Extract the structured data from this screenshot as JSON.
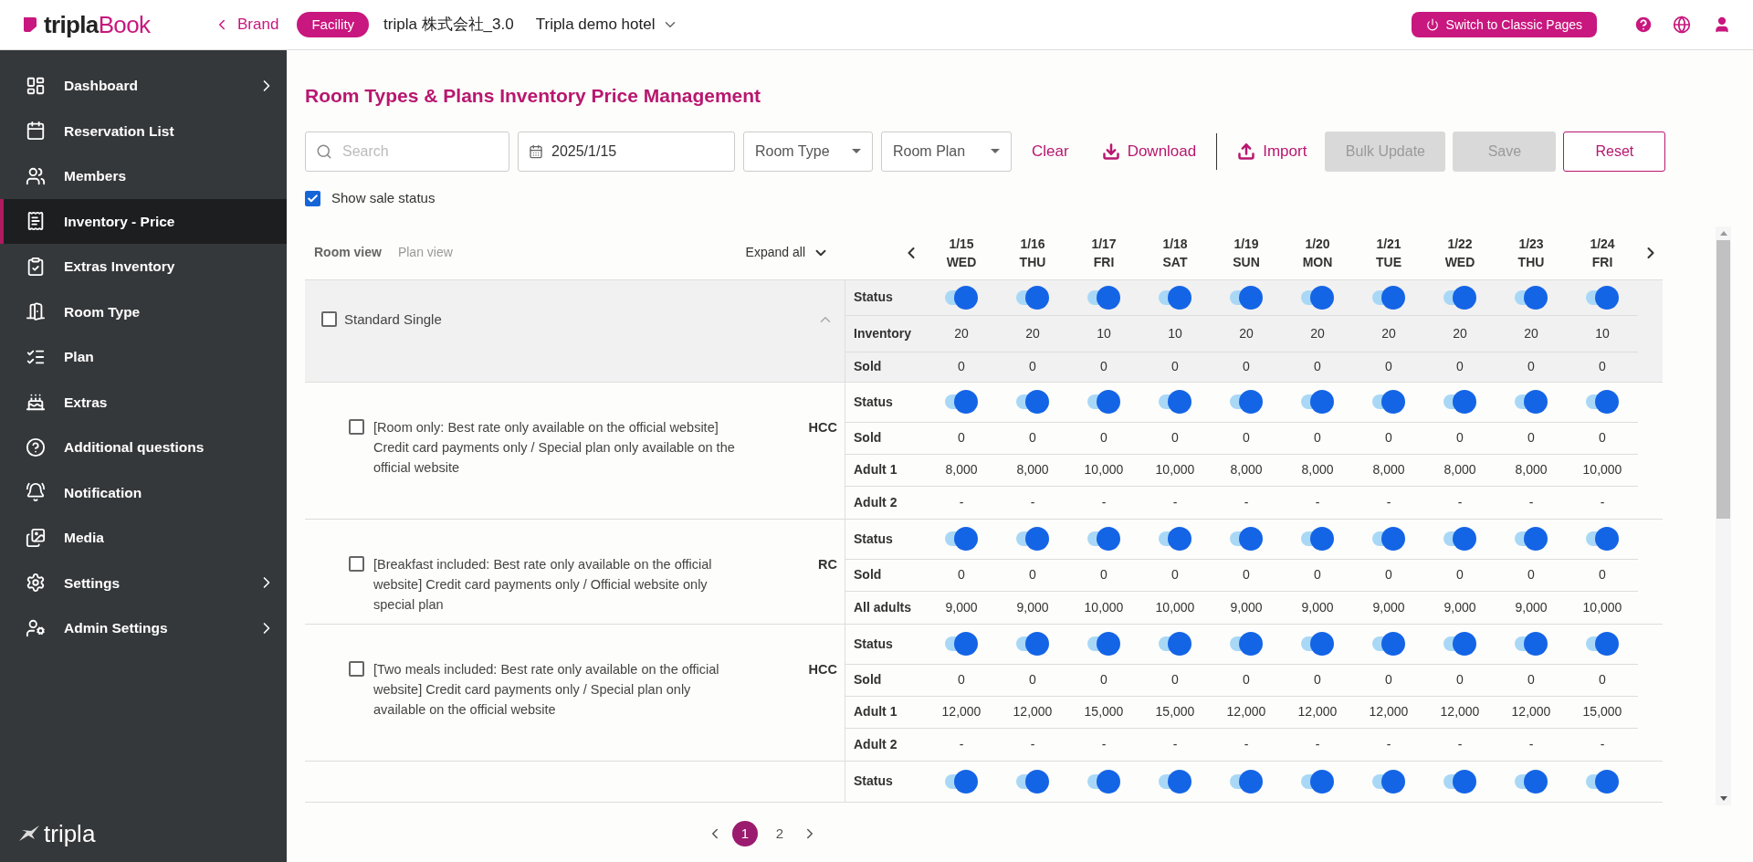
{
  "header": {
    "logo_part1": "tripla",
    "logo_part2": "Book",
    "back_link": "Brand",
    "facility_badge": "Facility",
    "company": "tripla 株式会社_3.0",
    "hotel": "Tripla demo hotel",
    "classic_button": "Switch to Classic Pages"
  },
  "sidebar": {
    "items": [
      {
        "label": "Dashboard",
        "selected": false,
        "has_submenu": true
      },
      {
        "label": "Reservation List",
        "selected": false,
        "has_submenu": false
      },
      {
        "label": "Members",
        "selected": false,
        "has_submenu": false
      },
      {
        "label": "Inventory - Price",
        "selected": true,
        "has_submenu": false
      },
      {
        "label": "Extras Inventory",
        "selected": false,
        "has_submenu": false
      },
      {
        "label": "Room Type",
        "selected": false,
        "has_submenu": false
      },
      {
        "label": "Plan",
        "selected": false,
        "has_submenu": false
      },
      {
        "label": "Extras",
        "selected": false,
        "has_submenu": false
      },
      {
        "label": "Additional questions",
        "selected": false,
        "has_submenu": false
      },
      {
        "label": "Notification",
        "selected": false,
        "has_submenu": false
      },
      {
        "label": "Media",
        "selected": false,
        "has_submenu": false
      },
      {
        "label": "Settings",
        "selected": false,
        "has_submenu": true
      },
      {
        "label": "Admin Settings",
        "selected": false,
        "has_submenu": true
      }
    ],
    "footer_logo": "tripla"
  },
  "page_title": "Room Types & Plans Inventory Price Management",
  "toolbar": {
    "search": {
      "placeholder": "Search"
    },
    "date": {
      "value": "2025/1/15"
    },
    "room_type": "Room Type",
    "room_plan": "Room Plan",
    "clear": "Clear",
    "download": "Download",
    "import": "Import",
    "bulk_update": {
      "label": "Bulk Update",
      "disabled": true
    },
    "save": {
      "label": "Save",
      "disabled": true
    },
    "reset": {
      "label": "Reset",
      "disabled": false
    }
  },
  "show_sale_status": {
    "label": "Show sale status",
    "checked": true
  },
  "view_tabs": [
    {
      "label": "Room view",
      "selected": true
    },
    {
      "label": "Plan view",
      "selected": false
    }
  ],
  "expand_all": "Expand all",
  "dates": [
    {
      "date": "1/15",
      "day": "WED"
    },
    {
      "date": "1/16",
      "day": "THU"
    },
    {
      "date": "1/17",
      "day": "FRI"
    },
    {
      "date": "1/18",
      "day": "SAT"
    },
    {
      "date": "1/19",
      "day": "SUN"
    },
    {
      "date": "1/20",
      "day": "MON"
    },
    {
      "date": "1/21",
      "day": "TUE"
    },
    {
      "date": "1/22",
      "day": "WED"
    },
    {
      "date": "1/23",
      "day": "THU"
    },
    {
      "date": "1/24",
      "day": "FRI"
    }
  ],
  "groups": [
    {
      "kind": "room",
      "name": "Standard Single",
      "checked": false,
      "expanded": true,
      "rows": [
        {
          "kind": "status",
          "label": "Status",
          "on": [
            true,
            true,
            true,
            true,
            true,
            true,
            true,
            true,
            true,
            true
          ]
        },
        {
          "kind": "values",
          "label": "Inventory",
          "values": [
            "20",
            "20",
            "10",
            "10",
            "20",
            "20",
            "20",
            "20",
            "20",
            "10"
          ]
        },
        {
          "kind": "values",
          "label": "Sold",
          "values": [
            "0",
            "0",
            "0",
            "0",
            "0",
            "0",
            "0",
            "0",
            "0",
            "0"
          ]
        }
      ]
    },
    {
      "kind": "plan",
      "name": "[Room only: Best rate only available on the official website] Credit card payments only / Special plan only available on the official website",
      "code": "HCC",
      "checked": false,
      "rows": [
        {
          "kind": "status",
          "label": "Status",
          "on": [
            true,
            true,
            true,
            true,
            true,
            true,
            true,
            true,
            true,
            true
          ]
        },
        {
          "kind": "values",
          "label": "Sold",
          "values": [
            "0",
            "0",
            "0",
            "0",
            "0",
            "0",
            "0",
            "0",
            "0",
            "0"
          ]
        },
        {
          "kind": "values",
          "label": "Adult 1",
          "values": [
            "8,000",
            "8,000",
            "10,000",
            "10,000",
            "8,000",
            "8,000",
            "8,000",
            "8,000",
            "8,000",
            "10,000"
          ]
        },
        {
          "kind": "values",
          "label": "Adult 2",
          "values": [
            "-",
            "-",
            "-",
            "-",
            "-",
            "-",
            "-",
            "-",
            "-",
            "-"
          ]
        }
      ]
    },
    {
      "kind": "plan",
      "name": "[Breakfast included: Best rate only available on the official website] Credit card payments only / Official website only special plan",
      "code": "RC",
      "checked": false,
      "rows": [
        {
          "kind": "status",
          "label": "Status",
          "on": [
            true,
            true,
            true,
            true,
            true,
            true,
            true,
            true,
            true,
            true
          ]
        },
        {
          "kind": "values",
          "label": "Sold",
          "values": [
            "0",
            "0",
            "0",
            "0",
            "0",
            "0",
            "0",
            "0",
            "0",
            "0"
          ]
        },
        {
          "kind": "values",
          "label": "All adults",
          "values": [
            "9,000",
            "9,000",
            "10,000",
            "10,000",
            "9,000",
            "9,000",
            "9,000",
            "9,000",
            "9,000",
            "10,000"
          ]
        }
      ]
    },
    {
      "kind": "plan",
      "name": "[Two meals included: Best rate only available on the official website] Credit card payments only / Special plan only available on the official website",
      "code": "HCC",
      "checked": false,
      "rows": [
        {
          "kind": "status",
          "label": "Status",
          "on": [
            true,
            true,
            true,
            true,
            true,
            true,
            true,
            true,
            true,
            true
          ]
        },
        {
          "kind": "values",
          "label": "Sold",
          "values": [
            "0",
            "0",
            "0",
            "0",
            "0",
            "0",
            "0",
            "0",
            "0",
            "0"
          ]
        },
        {
          "kind": "values",
          "label": "Adult 1",
          "values": [
            "12,000",
            "12,000",
            "15,000",
            "15,000",
            "12,000",
            "12,000",
            "12,000",
            "12,000",
            "12,000",
            "15,000"
          ]
        },
        {
          "kind": "values",
          "label": "Adult 2",
          "values": [
            "-",
            "-",
            "-",
            "-",
            "-",
            "-",
            "-",
            "-",
            "-",
            "-"
          ]
        }
      ]
    },
    {
      "kind": "plan",
      "rows": [
        {
          "kind": "status",
          "label": "Status",
          "on": [
            true,
            true,
            true,
            true,
            true,
            true,
            true,
            true,
            true,
            true
          ]
        }
      ]
    }
  ],
  "pagination": [
    {
      "label": "1",
      "selected": true
    },
    {
      "label": "2",
      "selected": false
    }
  ]
}
